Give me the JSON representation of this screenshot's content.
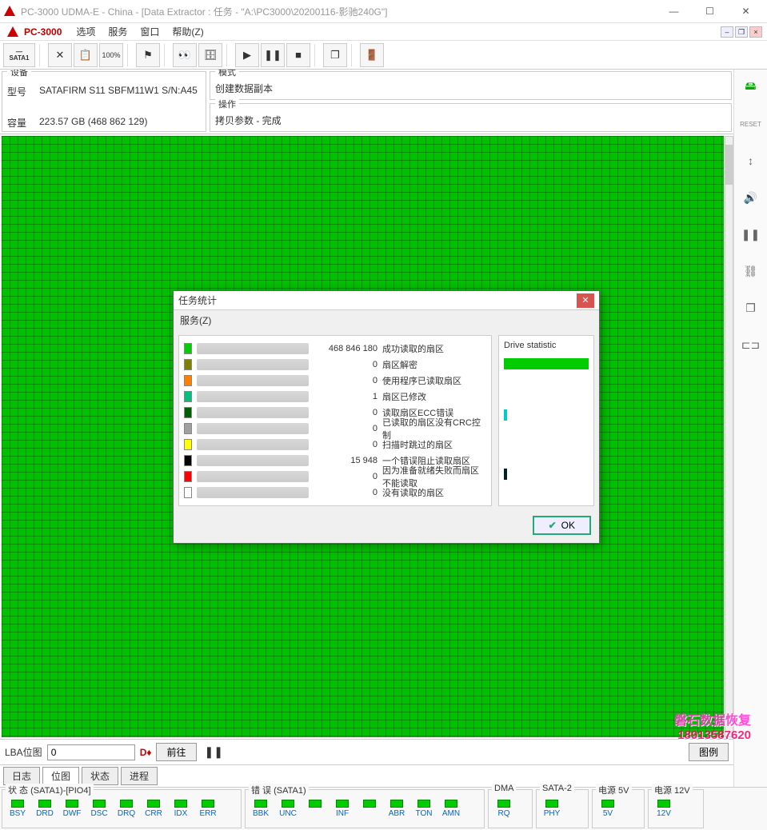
{
  "window": {
    "title": "PC-3000 UDMA-E - China - [Data Extractor : 任务 - \"A:\\PC3000\\20200116-影驰240G\"]"
  },
  "menu": {
    "app_name": "PC-3000",
    "items": [
      "选项",
      "服务",
      "窗口",
      "帮助(Z)"
    ]
  },
  "toolbar": {
    "sata1": "SATA1"
  },
  "device_panel": {
    "label": "设备",
    "model_key": "型号",
    "model_val": "SATAFIRM   S11 SBFM11W1 S/N:A45",
    "capacity_key": "容量",
    "capacity_val": "223.57 GB (468 862 129)"
  },
  "mode_panel": {
    "label": "模式",
    "value": "创建数据副本"
  },
  "op_panel": {
    "label": "操作",
    "value": "拷贝参数 - 完成"
  },
  "map_controls": {
    "lba_label": "LBA位图",
    "lba_value": "0",
    "go_label": "前往",
    "legend_label": "图例"
  },
  "tabs": [
    "日志",
    "位图",
    "状态",
    "进程"
  ],
  "tabs_active_index": 1,
  "status_groups": {
    "g1": {
      "label": "状 态 (SATA1)-[PIO4]",
      "flags": [
        "BSY",
        "DRD",
        "DWF",
        "DSC",
        "DRQ",
        "CRR",
        "IDX",
        "ERR"
      ]
    },
    "g2": {
      "label": "错 误 (SATA1)",
      "flags": [
        "BBK",
        "UNC",
        "",
        "INF",
        "",
        "ABR",
        "TON",
        "AMN"
      ]
    },
    "g3": {
      "label": "DMA",
      "flags": [
        "RQ"
      ]
    },
    "g4": {
      "label": "SATA-2",
      "flags": [
        "PHY"
      ]
    },
    "g5": {
      "label": "电源 5V",
      "flags": [
        "5V"
      ]
    },
    "g6": {
      "label": "电源 12V",
      "flags": [
        "12V"
      ]
    }
  },
  "dialog": {
    "title": "任务统计",
    "menu": "服务(Z)",
    "drive_stat_label": "Drive statistic",
    "ok_label": "OK",
    "stats": [
      {
        "color": "#00d000",
        "value": "468 846 180",
        "label": "成功读取的扇区"
      },
      {
        "color": "#808000",
        "value": "0",
        "label": "扇区解密"
      },
      {
        "color": "#ff8000",
        "value": "0",
        "label": "使用程序已读取扇区"
      },
      {
        "color": "#00c080",
        "value": "1",
        "label": "扇区已修改"
      },
      {
        "color": "#006000",
        "value": "0",
        "label": "读取扇区ECC错误"
      },
      {
        "color": "#a0a0a0",
        "value": "0",
        "label": "已读取的扇区没有CRC控制"
      },
      {
        "color": "#ffff00",
        "value": "0",
        "label": "扫描时跳过的扇区"
      },
      {
        "color": "#000000",
        "value": "15 948",
        "label": "一个错误阻止读取扇区"
      },
      {
        "color": "#ff0000",
        "value": "0",
        "label": "因为准备就绪失败而扇区不能读取"
      },
      {
        "color": "#ffffff",
        "value": "0",
        "label": "没有读取的扇区"
      }
    ]
  },
  "watermark": {
    "line1": "磐石数据恢复",
    "line2": "18913587620"
  }
}
